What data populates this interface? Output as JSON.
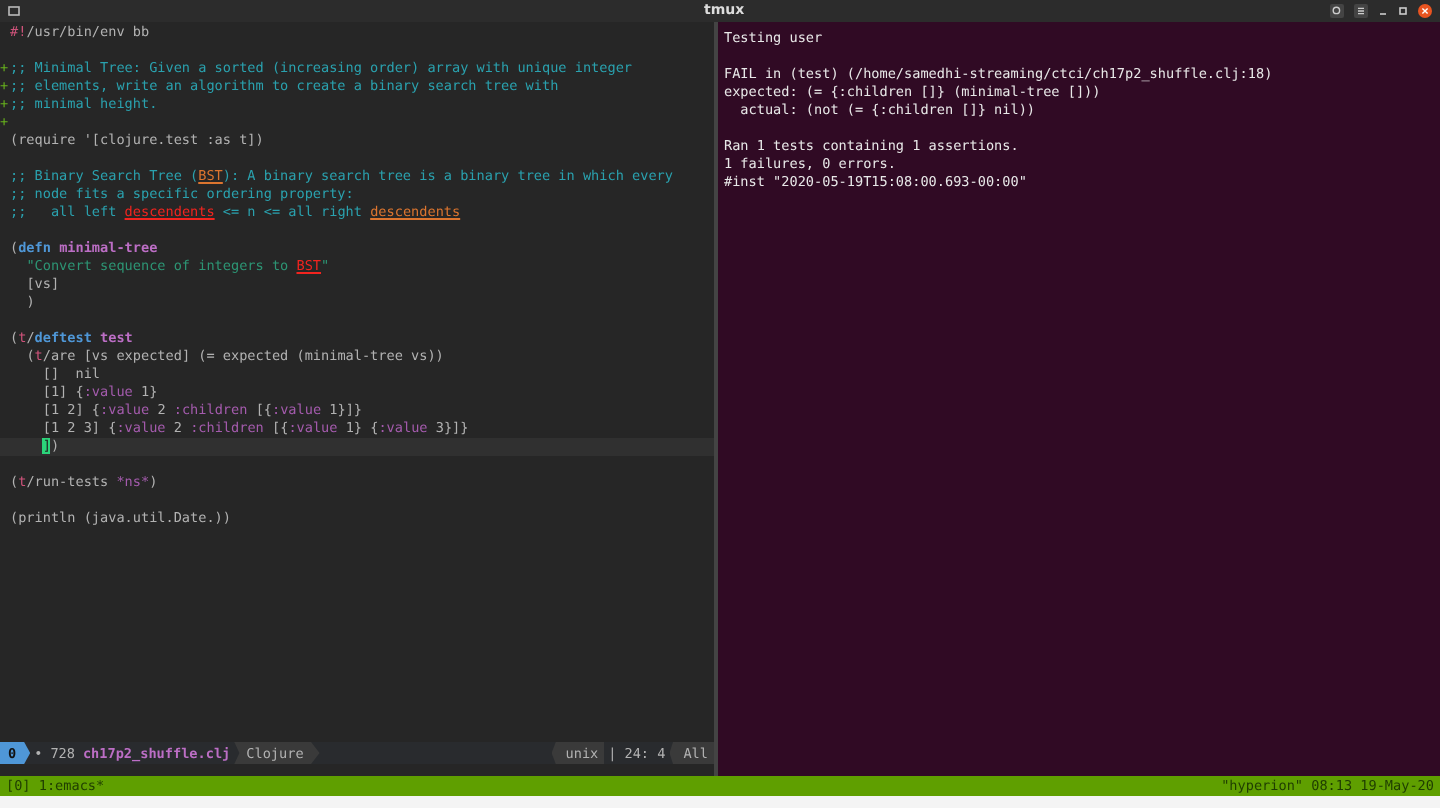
{
  "window": {
    "title": "tmux"
  },
  "editor": {
    "blocks": [
      [
        {
          "tokens": [
            {
              "text": "#!",
              "kind": "shebang"
            },
            {
              "text": "/usr/bin/env bb",
              "kind": "plain"
            }
          ]
        }
      ],
      [
        {
          "gutter": "+",
          "tokens": [
            {
              "text": ";; Minimal Tree: Given a sorted (increasing order) array with unique integer",
              "kind": "comment"
            }
          ]
        },
        {
          "gutter": "+",
          "tokens": [
            {
              "text": ";; elements, write an algorithm to create a binary search tree with",
              "kind": "comment"
            }
          ]
        },
        {
          "gutter": "+",
          "tokens": [
            {
              "text": ";; minimal height.",
              "kind": "comment"
            }
          ]
        },
        {
          "gutter": "+"
        },
        {
          "tokens": [
            {
              "text": "(require '[clojure.test :as t])",
              "kind": "plain"
            }
          ]
        }
      ],
      [
        {
          "tokens": [
            {
              "text": ";; Binary Search Tree (",
              "kind": "comment"
            },
            {
              "text": "BST",
              "kind": "warn"
            },
            {
              "text": "): A binary search tree is a binary tree in which every",
              "kind": "comment"
            }
          ]
        },
        {
          "tokens": [
            {
              "text": ";; node fits a specific ordering property:",
              "kind": "comment"
            }
          ]
        },
        {
          "tokens": [
            {
              "text": ";;   all left ",
              "kind": "comment"
            },
            {
              "text": "descendents",
              "kind": "error"
            },
            {
              "text": " <= n <= all right ",
              "kind": "comment"
            },
            {
              "text": "descendents",
              "kind": "warn"
            }
          ]
        }
      ],
      [
        {
          "tokens": [
            {
              "text": "(",
              "kind": "plain"
            },
            {
              "text": "defn",
              "kind": "def"
            },
            {
              "text": " minimal-tree",
              "kind": "name"
            }
          ]
        },
        {
          "tokens": [
            {
              "text": "  \"Convert sequence of integers to ",
              "kind": "string"
            },
            {
              "text": "BST",
              "kind": "error"
            },
            {
              "text": "\"",
              "kind": "string"
            }
          ]
        },
        {
          "tokens": [
            {
              "text": "  [vs]",
              "kind": "plain"
            }
          ]
        },
        {
          "tokens": [
            {
              "text": "  )",
              "kind": "plain"
            }
          ]
        }
      ],
      [
        {
          "tokens": [
            {
              "text": "(",
              "kind": "plain"
            },
            {
              "text": "t",
              "kind": "ns"
            },
            {
              "text": "/",
              "kind": "plain"
            },
            {
              "text": "deftest",
              "kind": "def"
            },
            {
              "text": " test",
              "kind": "name"
            }
          ]
        },
        {
          "tokens": [
            {
              "text": "  (",
              "kind": "plain"
            },
            {
              "text": "t",
              "kind": "ns"
            },
            {
              "text": "/are [vs expected] (= expected (minimal-tree vs))",
              "kind": "plain"
            }
          ]
        },
        {
          "tokens": [
            {
              "text": "    []  nil",
              "kind": "plain"
            }
          ]
        },
        {
          "tokens": [
            {
              "text": "    [1] {",
              "kind": "plain"
            },
            {
              "text": ":value",
              "kind": "keyword"
            },
            {
              "text": " 1}",
              "kind": "plain"
            }
          ]
        },
        {
          "tokens": [
            {
              "text": "    [1 2] {",
              "kind": "plain"
            },
            {
              "text": ":value",
              "kind": "keyword"
            },
            {
              "text": " 2 ",
              "kind": "plain"
            },
            {
              "text": ":children",
              "kind": "keyword"
            },
            {
              "text": " [{",
              "kind": "plain"
            },
            {
              "text": ":value",
              "kind": "keyword"
            },
            {
              "text": " 1}]}",
              "kind": "plain"
            }
          ]
        },
        {
          "tokens": [
            {
              "text": "    [1 2 3] {",
              "kind": "plain"
            },
            {
              "text": ":value",
              "kind": "keyword"
            },
            {
              "text": " 2 ",
              "kind": "plain"
            },
            {
              "text": ":children",
              "kind": "keyword"
            },
            {
              "text": " [{",
              "kind": "plain"
            },
            {
              "text": ":value",
              "kind": "keyword"
            },
            {
              "text": " 1} {",
              "kind": "plain"
            },
            {
              "text": ":value",
              "kind": "keyword"
            },
            {
              "text": " 3}]}",
              "kind": "plain"
            }
          ]
        },
        {
          "current": true,
          "tokens": [
            {
              "text": "    ]",
              "kind": "cursor"
            },
            {
              "text": ")",
              "kind": "plain"
            }
          ]
        }
      ],
      [
        {
          "tokens": [
            {
              "text": "(",
              "kind": "plain"
            },
            {
              "text": "t",
              "kind": "ns"
            },
            {
              "text": "/run-tests ",
              "kind": "plain"
            },
            {
              "text": "*ns*",
              "kind": "keyword"
            },
            {
              "text": ")",
              "kind": "plain"
            }
          ]
        }
      ],
      [
        {
          "tokens": [
            {
              "text": "(println (java.util.Date.))",
              "kind": "plain"
            }
          ]
        }
      ]
    ]
  },
  "mode_line": {
    "window_number": "0",
    "modified": "•",
    "size": "728",
    "buffer": "ch17p2_shuffle.clj",
    "mode": "Clojure",
    "encoding": "unix",
    "separator": "|",
    "position": "24: 4",
    "scroll": "All"
  },
  "terminal": {
    "blocks": [
      [
        "Testing user"
      ],
      [
        "FAIL in (test) (/home/samedhi-streaming/ctci/ch17p2_shuffle.clj:18)",
        "expected: (= {:children []} (minimal-tree []))",
        "  actual: (not (= {:children []} nil))"
      ],
      [
        "Ran 1 tests containing 1 assertions.",
        "1 failures, 0 errors.",
        "#inst \"2020-05-19T15:08:00.693-00:00\""
      ]
    ]
  },
  "tmux_bar": {
    "left": "[0] 1:emacs*",
    "right": "\"hyperion\" 08:13 19-May-20"
  }
}
